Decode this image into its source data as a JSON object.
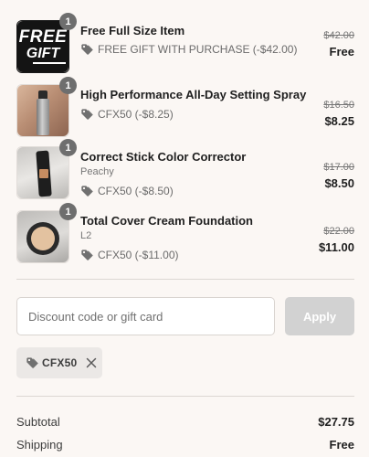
{
  "items": [
    {
      "quantity": "1",
      "name": "Free Full Size Item",
      "variant": "",
      "discount": "FREE GIFT WITH PURCHASE (-$42.00)",
      "original_price": "$42.00",
      "price": "Free",
      "thumbnail_text_line1": "FREE",
      "thumbnail_text_line2": "GIFT"
    },
    {
      "quantity": "1",
      "name": "High Performance All-Day Setting Spray",
      "variant": "",
      "discount": "CFX50 (-$8.25)",
      "original_price": "$16.50",
      "price": "$8.25"
    },
    {
      "quantity": "1",
      "name": "Correct Stick Color Corrector",
      "variant": "Peachy",
      "discount": "CFX50 (-$8.50)",
      "original_price": "$17.00",
      "price": "$8.50"
    },
    {
      "quantity": "1",
      "name": "Total Cover Cream Foundation",
      "variant": "L2",
      "discount": "CFX50 (-$11.00)",
      "original_price": "$22.00",
      "price": "$11.00"
    }
  ],
  "discount_field": {
    "placeholder": "Discount code or gift card",
    "value": "",
    "apply_label": "Apply"
  },
  "applied_code": "CFX50",
  "summary": {
    "subtotal_label": "Subtotal",
    "subtotal_value": "$27.75",
    "shipping_label": "Shipping",
    "shipping_value": "Free"
  },
  "colors": {
    "background": "#fbf7f4",
    "apply_disabled": "#d2d2d2",
    "quantity_badge": "#6e6e6e"
  }
}
